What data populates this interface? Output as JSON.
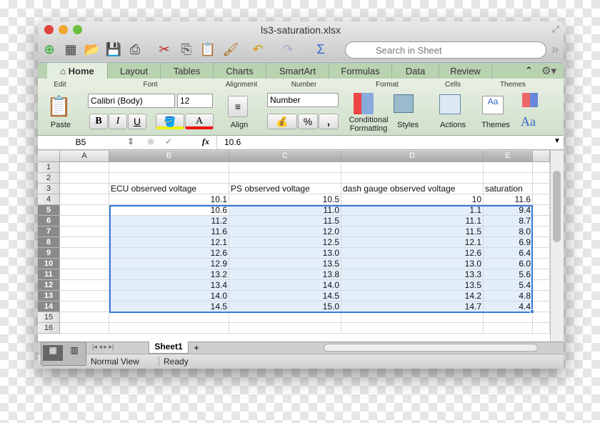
{
  "window": {
    "title": "ls3-saturation.xlsx"
  },
  "toolbar": {
    "search_placeholder": "Search in Sheet"
  },
  "ribbon_tabs": [
    "Home",
    "Layout",
    "Tables",
    "Charts",
    "SmartArt",
    "Formulas",
    "Data",
    "Review"
  ],
  "active_tab": "Home",
  "ribbon": {
    "groups": [
      "Edit",
      "Font",
      "Alignment",
      "Number",
      "Format",
      "Cells",
      "Themes"
    ],
    "paste": "Paste",
    "font_name": "Calibri (Body)",
    "font_size": "12",
    "bold": "B",
    "italic": "I",
    "underline": "U",
    "font_color": "A",
    "align": "Align",
    "number_format": "Number",
    "percent": "%",
    "comma": ",",
    "conditional_formatting": "Conditional Formatting",
    "styles": "Styles",
    "actions": "Actions",
    "themes": "Themes",
    "theme_fonts": "Aa"
  },
  "formula_bar": {
    "name_box": "B5",
    "fx": "fx",
    "value": "10.6"
  },
  "columns": [
    "A",
    "B",
    "C",
    "D",
    "E"
  ],
  "selected_columns": [
    "B",
    "C",
    "D",
    "E"
  ],
  "rows": [
    {
      "n": "1",
      "cells": [
        "",
        "",
        "",
        "",
        ""
      ]
    },
    {
      "n": "2",
      "cells": [
        "",
        "",
        "",
        "",
        ""
      ]
    },
    {
      "n": "3",
      "cells": [
        "",
        "ECU observed voltage",
        "PS observed voltage",
        "dash gauge observed voltage",
        "saturation"
      ]
    },
    {
      "n": "4",
      "cells": [
        "",
        "10.1",
        "10.5",
        "10",
        "11.6"
      ]
    },
    {
      "n": "5",
      "cells": [
        "",
        "10.6",
        "11.0",
        "1.1",
        "9.4"
      ]
    },
    {
      "n": "6",
      "cells": [
        "",
        "11.2",
        "11.5",
        "11.1",
        "8.7"
      ]
    },
    {
      "n": "7",
      "cells": [
        "",
        "11.6",
        "12.0",
        "11.5",
        "8.0"
      ]
    },
    {
      "n": "8",
      "cells": [
        "",
        "12.1",
        "12.5",
        "12.1",
        "6.9"
      ]
    },
    {
      "n": "9",
      "cells": [
        "",
        "12.6",
        "13.0",
        "12.6",
        "6.4"
      ]
    },
    {
      "n": "10",
      "cells": [
        "",
        "12.9",
        "13.5",
        "13.0",
        "6.0"
      ]
    },
    {
      "n": "11",
      "cells": [
        "",
        "13.2",
        "13.8",
        "13.3",
        "5.6"
      ]
    },
    {
      "n": "12",
      "cells": [
        "",
        "13.4",
        "14.0",
        "13.5",
        "5.4"
      ]
    },
    {
      "n": "13",
      "cells": [
        "",
        "14.0",
        "14.5",
        "14.2",
        "4.8"
      ]
    },
    {
      "n": "14",
      "cells": [
        "",
        "14.5",
        "15.0",
        "14.7",
        "4.4"
      ]
    },
    {
      "n": "15",
      "cells": [
        "",
        "",
        "",
        "",
        ""
      ]
    },
    {
      "n": "16",
      "cells": [
        "",
        "",
        "",
        "",
        ""
      ]
    }
  ],
  "selection": {
    "range": "B5:E14",
    "highlight_color": "#e3eefb",
    "border_color": "#3a78d6"
  },
  "sheet_tabs": [
    "Sheet1"
  ],
  "add_sheet": "+",
  "status": {
    "view": "Normal View",
    "state": "Ready"
  }
}
